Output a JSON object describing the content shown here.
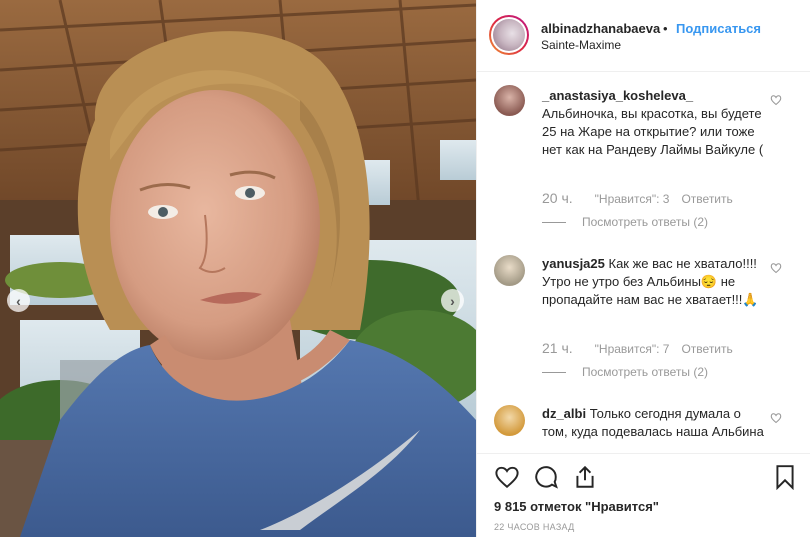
{
  "post": {
    "username": "albinadzhanabaeva",
    "separator": "•",
    "follow_label": "Подписаться",
    "location": "Sainte-Maxime",
    "likes_text": "9 815 отметок \"Нравится\"",
    "time_ago": "22 ЧАСОВ НАЗАД"
  },
  "comments": [
    {
      "user": "_anastasiya_kosheleva_",
      "text": "Альбиночка, вы красотка, вы будете 25 на Жаре на открытие? или тоже нет как на Рандеву Лаймы Вайкуле (",
      "time": "20 ч.",
      "likes": "\"Нравится\": 3",
      "reply": "Ответить",
      "view_replies": "Посмотреть ответы (2)"
    },
    {
      "user": "yanusja25",
      "text": "Как же вас не хватало!!!! Утро не утро без Альбины😔 не пропадайте нам вас не хватает!!!🙏",
      "time": "21 ч.",
      "likes": "\"Нравится\": 7",
      "reply": "Ответить",
      "view_replies": "Посмотреть ответы (2)"
    },
    {
      "user": "dz_albi",
      "text": "Только сегодня думала о том, куда подевалась наша Альбина"
    }
  ],
  "icons": {
    "carousel_prev": "chevron-left-icon",
    "carousel_next": "chevron-right-icon",
    "like": "heart-icon",
    "comment": "comment-icon",
    "share": "share-icon",
    "save": "bookmark-icon"
  },
  "colors": {
    "accent": "#3897f0",
    "text": "#262626",
    "muted": "#999999",
    "shirt": "#4a6ea8"
  }
}
